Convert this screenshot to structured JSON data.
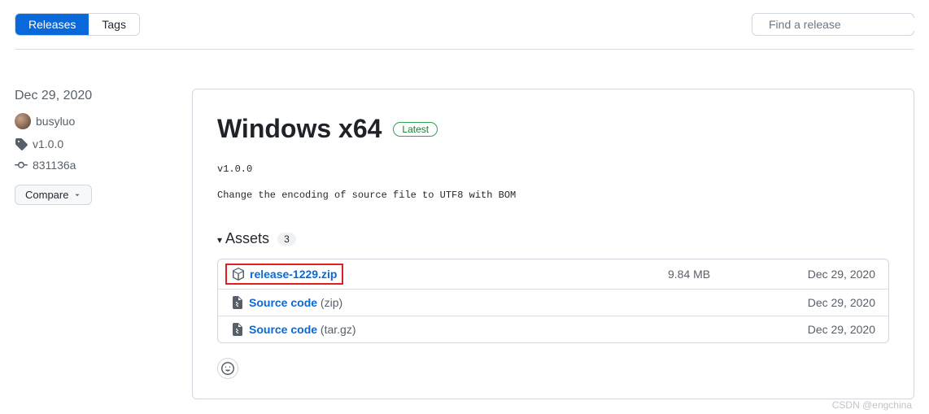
{
  "tabs": {
    "releases": "Releases",
    "tags": "Tags"
  },
  "search": {
    "placeholder": "Find a release"
  },
  "sidebar": {
    "date": "Dec 29, 2020",
    "author": "busyluo",
    "tag": "v1.0.0",
    "commit": "831136a",
    "compare": "Compare"
  },
  "release": {
    "title": "Windows x64",
    "badge": "Latest",
    "version": "v1.0.0",
    "description": "Change the encoding of source file to UTF8 with BOM"
  },
  "assets": {
    "label": "Assets",
    "count": "3",
    "rows": [
      {
        "name": "release-1229.zip",
        "suffix": "",
        "size": "9.84 MB",
        "date": "Dec 29, 2020",
        "icon": "package",
        "highlight": true
      },
      {
        "name": "Source code",
        "suffix": " (zip)",
        "size": "",
        "date": "Dec 29, 2020",
        "icon": "zip",
        "highlight": false
      },
      {
        "name": "Source code",
        "suffix": " (tar.gz)",
        "size": "",
        "date": "Dec 29, 2020",
        "icon": "zip",
        "highlight": false
      }
    ]
  },
  "watermark": "CSDN @engchina"
}
